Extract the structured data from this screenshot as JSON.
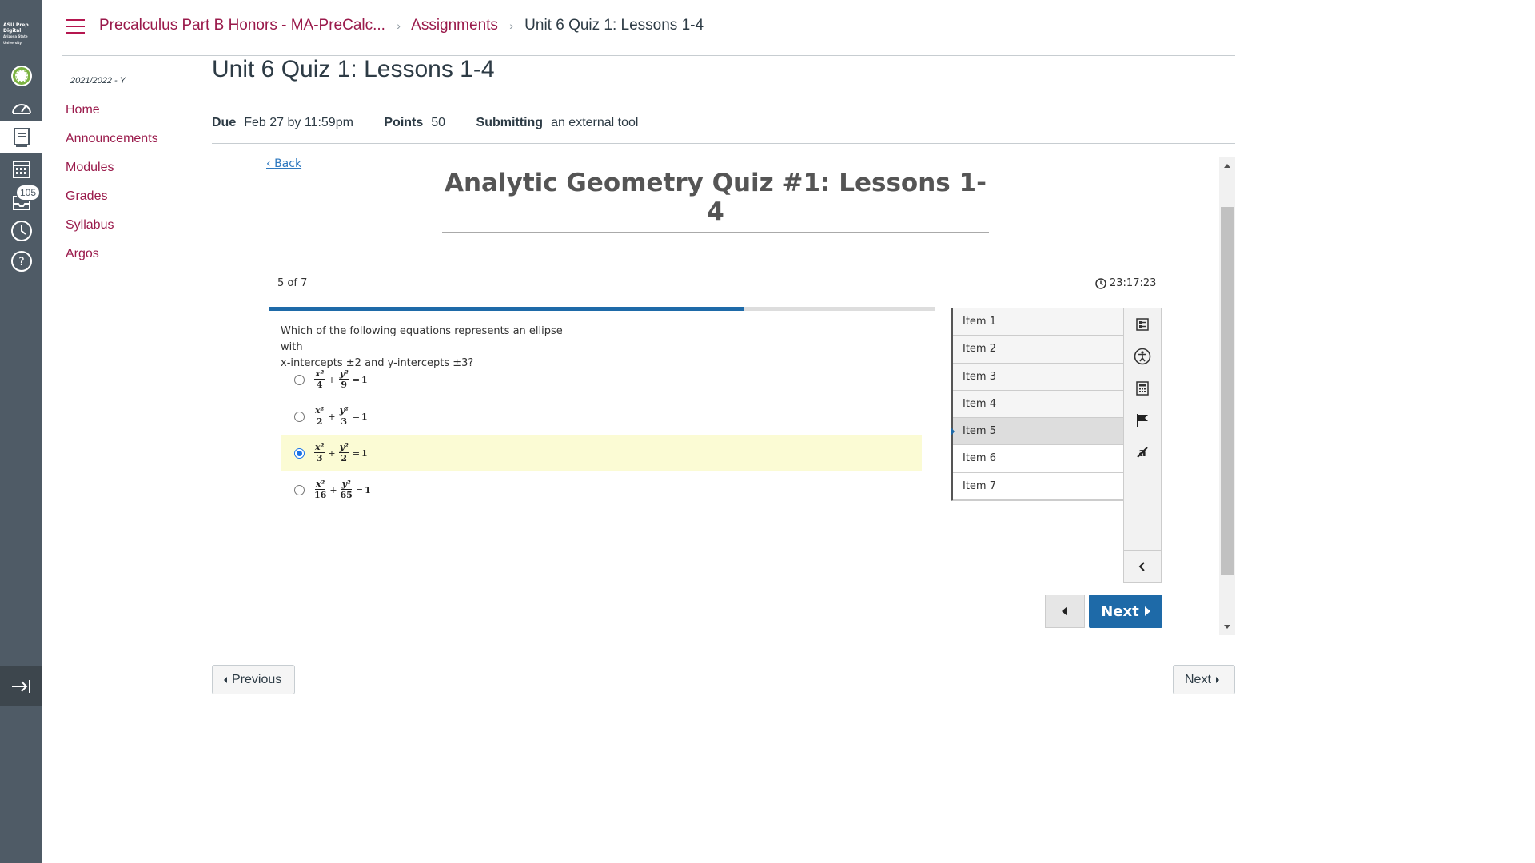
{
  "brand": {
    "logo_main": "ASU Prep Digital",
    "logo_sub": "Arizona State University"
  },
  "global_nav": {
    "inbox_badge": "105",
    "icons": [
      "account-icon",
      "dashboard-icon",
      "courses-icon",
      "calendar-icon",
      "inbox-icon",
      "history-icon",
      "help-icon"
    ]
  },
  "breadcrumb": {
    "course": "Precalculus Part B Honors - MA-PreCalc...",
    "section": "Assignments",
    "current": "Unit 6 Quiz 1: Lessons 1-4"
  },
  "course_nav": {
    "term": "2021/2022 - Y",
    "items": [
      {
        "label": "Home"
      },
      {
        "label": "Announcements"
      },
      {
        "label": "Modules"
      },
      {
        "label": "Grades"
      },
      {
        "label": "Syllabus"
      },
      {
        "label": "Argos"
      }
    ]
  },
  "assignment": {
    "title": "Unit 6 Quiz 1: Lessons 1-4",
    "due_label": "Due",
    "due_value": "Feb 27 by 11:59pm",
    "points_label": "Points",
    "points_value": "50",
    "submitting_label": "Submitting",
    "submitting_value": "an external tool"
  },
  "quiz": {
    "back_label": "Back",
    "title": "Analytic Geometry Quiz #1: Lessons 1-4",
    "counter": "5 of 7",
    "timer": "23:17:23",
    "progress_fraction": 0.714,
    "question_line1": "Which of the following equations represents an ellipse with",
    "question_line2": "x-intercepts ±2 and y-intercepts ±3?",
    "options": [
      {
        "num1": "x²",
        "den1": "4",
        "num2": "y²",
        "den2": "9",
        "rhs": "1",
        "selected": false
      },
      {
        "num1": "x²",
        "den1": "2",
        "num2": "y²",
        "den2": "3",
        "rhs": "1",
        "selected": false
      },
      {
        "num1": "x²",
        "den1": "3",
        "num2": "y²",
        "den2": "2",
        "rhs": "1",
        "selected": true
      },
      {
        "num1": "x²",
        "den1": "16",
        "num2": "y²",
        "den2": "65",
        "rhs": "1",
        "selected": false
      }
    ],
    "items": [
      {
        "label": "Item 1"
      },
      {
        "label": "Item 2"
      },
      {
        "label": "Item 3"
      },
      {
        "label": "Item 4"
      },
      {
        "label": "Item 5"
      },
      {
        "label": "Item 6"
      },
      {
        "label": "Item 7"
      }
    ],
    "current_item": 5,
    "next_label": "Next"
  },
  "footer": {
    "previous_label": "Previous",
    "next_label": "Next"
  },
  "colors": {
    "brand": "#9a1a4b",
    "quiz_blue": "#1e6aa8",
    "selected_bg": "#fbfbd4",
    "nav_bg": "#4f5b66"
  }
}
